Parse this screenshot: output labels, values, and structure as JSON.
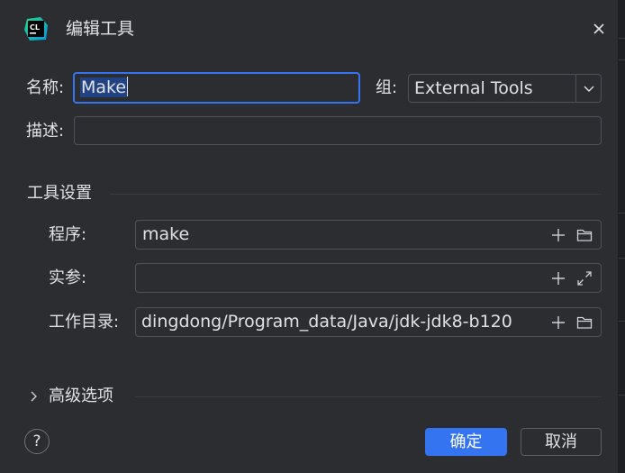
{
  "dialog": {
    "title": "编辑工具",
    "app_icon_text": "CL"
  },
  "form": {
    "name_label": "名称:",
    "name_value": "Make",
    "group_label": "组:",
    "group_value": "External Tools",
    "description_label": "描述:",
    "description_value": ""
  },
  "tool_settings": {
    "section_title": "工具设置",
    "program_label": "程序:",
    "program_value": "make",
    "arguments_label": "实参:",
    "arguments_value": "",
    "working_dir_label": "工作目录:",
    "working_dir_value": "dingdong/Program_data/Java/jdk-jdk8-b120"
  },
  "advanced": {
    "label": "高级选项"
  },
  "footer": {
    "help_label": "?",
    "ok_label": "确定",
    "cancel_label": "取消"
  },
  "colors": {
    "background": "#2b2d30",
    "accent": "#3574f0",
    "border": "#4e5157",
    "text": "#dfe1e5",
    "selection": "#214283"
  },
  "icons": {
    "app": "clion-logo-icon",
    "close": "close-icon",
    "dropdown": "chevron-down-icon",
    "insert_macro": "plus-icon",
    "browse": "folder-icon",
    "expand": "expand-icon",
    "advanced": "chevron-right-icon"
  }
}
